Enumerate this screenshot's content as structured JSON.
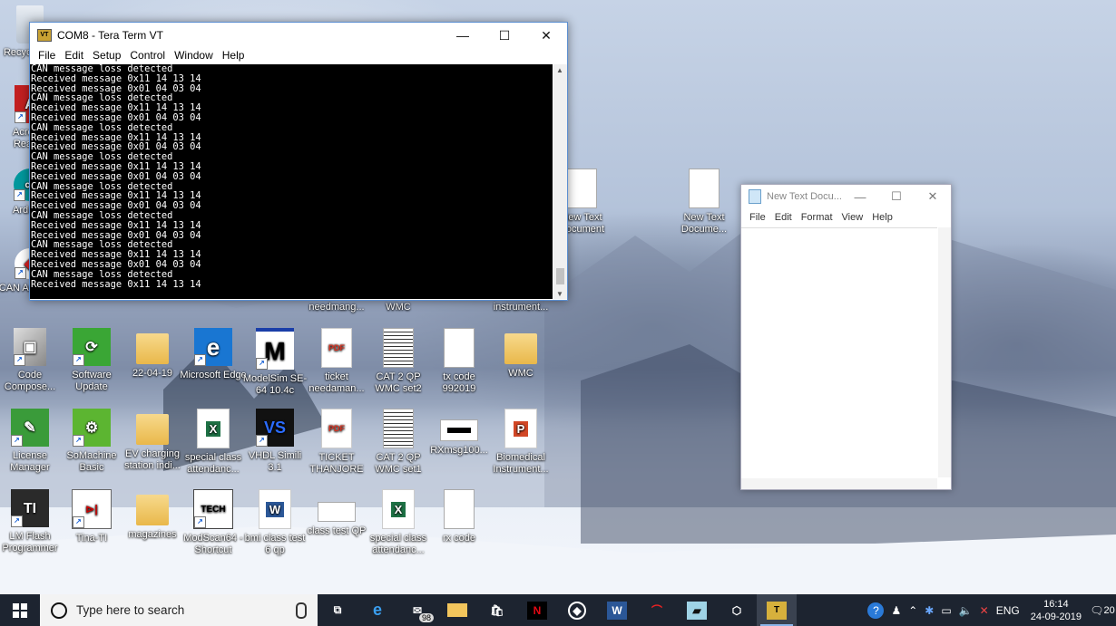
{
  "desktop_icons": [
    {
      "label": "Recycle Bin",
      "kind": "recycle"
    },
    {
      "label": "Acrobat Reader",
      "kind": "pdf"
    },
    {
      "label": "Arduino",
      "kind": "arduino"
    },
    {
      "label": "CAN Analyzer",
      "kind": "can"
    },
    {
      "label": "needmang...",
      "kind": "partial"
    },
    {
      "label": "WMC",
      "kind": "partial"
    },
    {
      "label": "instrument...",
      "kind": "partial"
    },
    {
      "label": "New Text Document",
      "kind": "doc"
    },
    {
      "label": "New Text Docume...",
      "kind": "doc"
    },
    {
      "label": "Code Compose...",
      "kind": "ccs"
    },
    {
      "label": "Software Update",
      "kind": "update"
    },
    {
      "label": "22-04-19",
      "kind": "folder"
    },
    {
      "label": "Microsoft Edge",
      "kind": "edge"
    },
    {
      "label": "ModelSim SE-64 10.4c",
      "kind": "modelsim"
    },
    {
      "label": "ticket needaman...",
      "kind": "pdf"
    },
    {
      "label": "CAT 2 QP WMC set2",
      "kind": "scan"
    },
    {
      "label": "tx code 992019",
      "kind": "doc"
    },
    {
      "label": "WMC",
      "kind": "folder"
    },
    {
      "label": "License Manager",
      "kind": "license"
    },
    {
      "label": "SoMachine Basic",
      "kind": "somachine"
    },
    {
      "label": "EV charging station indi...",
      "kind": "folder"
    },
    {
      "label": "special class attendanc...",
      "kind": "xls"
    },
    {
      "label": "VHDL Simili 3.1",
      "kind": "vhdl"
    },
    {
      "label": "TICKET THANJORE",
      "kind": "pdf"
    },
    {
      "label": "CAT 2 QP WMC set1",
      "kind": "scan"
    },
    {
      "label": "RXmsg100...",
      "kind": "img"
    },
    {
      "label": "Biomedical Instrument...",
      "kind": "ppt"
    },
    {
      "label": "LM Flash Programmer",
      "kind": "ti"
    },
    {
      "label": "Tina-TI",
      "kind": "tina"
    },
    {
      "label": "magazines",
      "kind": "folder"
    },
    {
      "label": "ModScan64 - Shortcut",
      "kind": "modscan"
    },
    {
      "label": "bmi class test 6 qp",
      "kind": "word"
    },
    {
      "label": "class test QP",
      "kind": "img"
    },
    {
      "label": "special class attendanc...",
      "kind": "xls"
    },
    {
      "label": "rx code",
      "kind": "doc"
    }
  ],
  "teraterm": {
    "title": "COM8 - Tera Term VT",
    "menu": [
      "File",
      "Edit",
      "Setup",
      "Control",
      "Window",
      "Help"
    ],
    "lines": [
      "CAN message loss detected",
      "Received message 0x11 14 13 14",
      "Received message 0x01 04 03 04",
      "CAN message loss detected",
      "Received message 0x11 14 13 14",
      "Received message 0x01 04 03 04",
      "CAN message loss detected",
      "Received message 0x11 14 13 14",
      "Received message 0x01 04 03 04",
      "CAN message loss detected",
      "Received message 0x11 14 13 14",
      "Received message 0x01 04 03 04",
      "CAN message loss detected",
      "Received message 0x11 14 13 14",
      "Received message 0x01 04 03 04",
      "CAN message loss detected",
      "Received message 0x11 14 13 14",
      "Received message 0x01 04 03 04",
      "CAN message loss detected",
      "Received message 0x11 14 13 14",
      "Received message 0x01 04 03 04",
      "CAN message loss detected",
      "Received message 0x11 14 13 14"
    ]
  },
  "notepad": {
    "title": "New Text Docu...",
    "menu": [
      "File",
      "Edit",
      "Format",
      "View",
      "Help"
    ],
    "content": ""
  },
  "taskbar": {
    "search_placeholder": "Type here to search",
    "mail_badge": "98",
    "apps": [
      "task-view",
      "edge",
      "mail",
      "file-explorer",
      "store",
      "netflix",
      "compass",
      "word",
      "acrobat",
      "notes",
      "3d",
      "teraterm"
    ],
    "tray": {
      "language": "ENG",
      "time": "16:14",
      "date": "24-09-2019",
      "notification_count": "20"
    }
  },
  "colors": {
    "accent": "#0078d7",
    "taskbar": "#1d2430",
    "terminal_bg": "#000000",
    "terminal_fg": "#ffffff"
  }
}
